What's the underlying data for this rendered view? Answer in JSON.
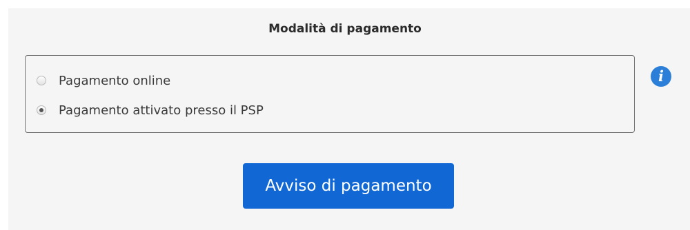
{
  "payment": {
    "title": "Modalità di pagamento",
    "options": [
      {
        "label": "Pagamento online",
        "selected": false
      },
      {
        "label": "Pagamento attivato presso il PSP",
        "selected": true
      }
    ],
    "info_icon": "info-icon",
    "info_glyph": "i",
    "button_label": "Avviso di pagamento"
  },
  "colors": {
    "accent": "#1167d4",
    "info": "#2c7fd8",
    "panel_bg": "#f5f5f5"
  }
}
